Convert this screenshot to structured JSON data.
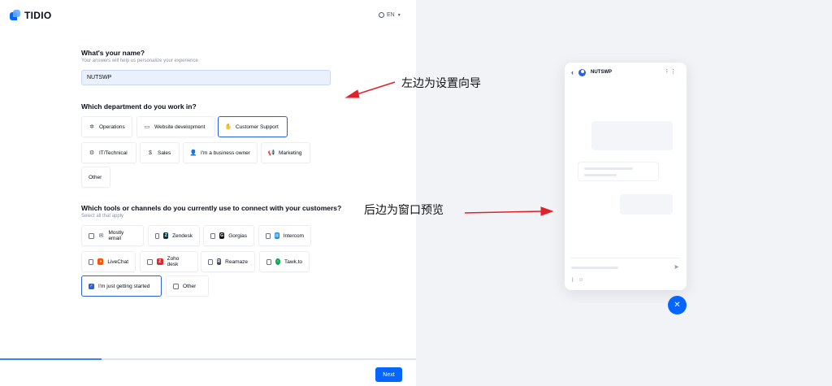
{
  "app": {
    "logo_text": "TIDIO",
    "language": "EN"
  },
  "q1": {
    "title": "What's your name?",
    "subtitle": "Your answers will help us personalize your experience",
    "value": "NUTSWP"
  },
  "q2": {
    "title": "Which department do you work in?",
    "options": [
      "Operations",
      "Website development",
      "Customer Support",
      "IT/Technical",
      "Sales",
      "I'm a business owner",
      "Marketing",
      "Other"
    ],
    "selected": "Customer Support"
  },
  "q3": {
    "title": "Which tools or channels do you currently use to connect with your customers?",
    "subtitle": "Select all that apply",
    "options": [
      "Mostly email",
      "Zendesk",
      "Gorgias",
      "Intercom",
      "LiveChat",
      "Zoho desk",
      "Reamaze",
      "Tawk.to",
      "I'm just getting started",
      "Other"
    ],
    "checked": [
      "I'm just getting started"
    ]
  },
  "progress": {
    "fraction": 0.245
  },
  "footer": {
    "next_label": "Next"
  },
  "annotations": {
    "left_label": "左边为设置向导",
    "right_label": "后边为窗口预览"
  },
  "widget": {
    "header_name": "NUTSWP"
  },
  "colors": {
    "accent": "#0566ff",
    "selected_border": "#2a61d9",
    "arrow": "#e0222a"
  }
}
